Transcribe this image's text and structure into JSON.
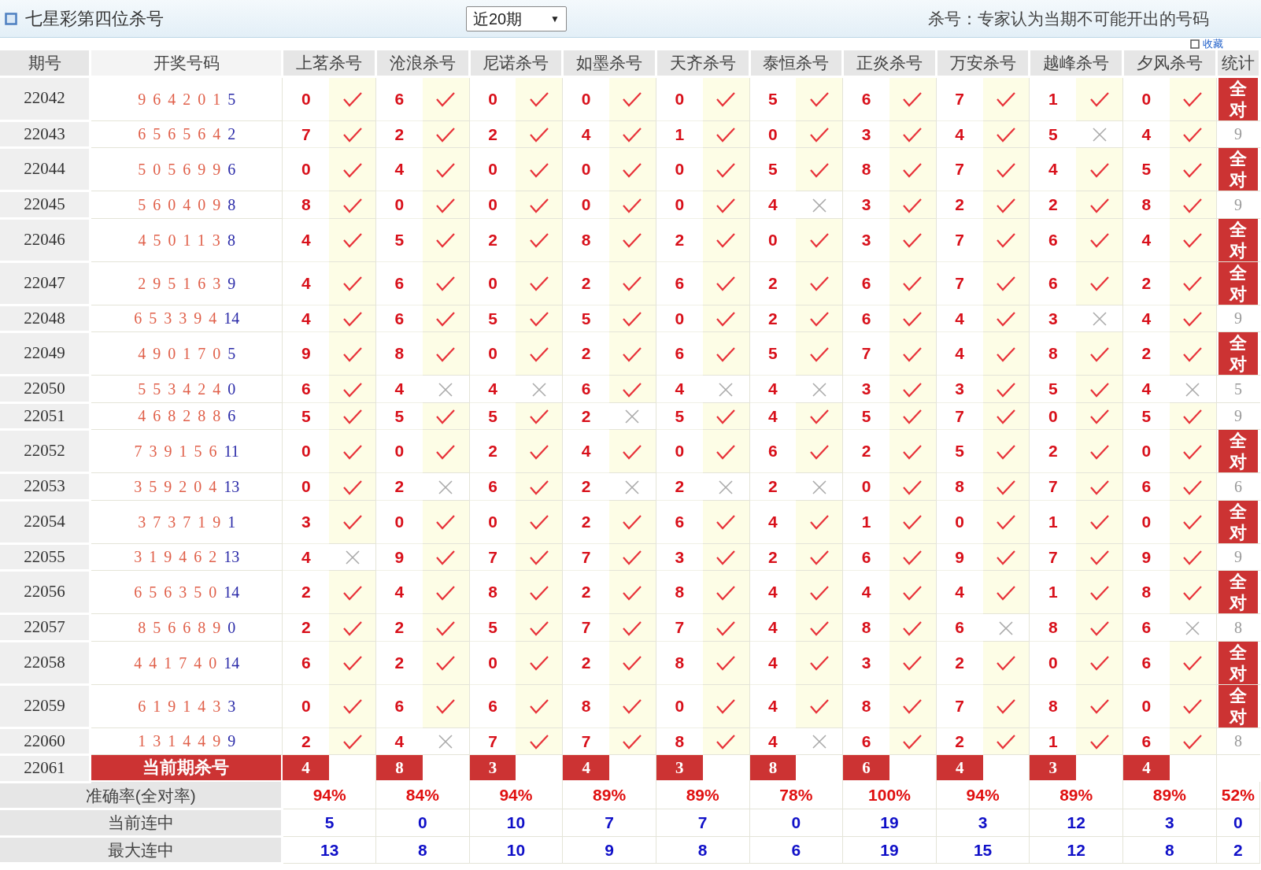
{
  "header": {
    "title": "七星彩第四位杀号",
    "period_select": {
      "value": "近20期",
      "arrow": "▼"
    },
    "note": "杀号：专家认为当期不可能开出的号码",
    "favorite": "收藏"
  },
  "table": {
    "columns": [
      "期号",
      "开奖号码",
      "上茗杀号",
      "沧浪杀号",
      "尼诺杀号",
      "如墨杀号",
      "天齐杀号",
      "泰恒杀号",
      "正炎杀号",
      "万安杀号",
      "越峰杀号",
      "夕风杀号",
      "统计"
    ],
    "rows": [
      {
        "period": "22042",
        "main": [
          "9",
          "6",
          "4",
          "2",
          "0",
          "1"
        ],
        "special": "5",
        "kills": [
          {
            "n": "0",
            "hit": true
          },
          {
            "n": "6",
            "hit": true
          },
          {
            "n": "0",
            "hit": true
          },
          {
            "n": "0",
            "hit": true
          },
          {
            "n": "0",
            "hit": true
          },
          {
            "n": "5",
            "hit": true
          },
          {
            "n": "6",
            "hit": true
          },
          {
            "n": "7",
            "hit": true
          },
          {
            "n": "1",
            "hit": true
          },
          {
            "n": "0",
            "hit": true
          }
        ],
        "stat": {
          "kind": "all_correct",
          "text": "全对"
        }
      },
      {
        "period": "22043",
        "main": [
          "6",
          "5",
          "6",
          "5",
          "6",
          "4"
        ],
        "special": "2",
        "kills": [
          {
            "n": "7",
            "hit": true
          },
          {
            "n": "2",
            "hit": true
          },
          {
            "n": "2",
            "hit": true
          },
          {
            "n": "4",
            "hit": true
          },
          {
            "n": "1",
            "hit": true
          },
          {
            "n": "0",
            "hit": true
          },
          {
            "n": "3",
            "hit": true
          },
          {
            "n": "4",
            "hit": true
          },
          {
            "n": "5",
            "hit": false
          },
          {
            "n": "4",
            "hit": true
          }
        ],
        "stat": {
          "kind": "count",
          "text": "9"
        }
      },
      {
        "period": "22044",
        "main": [
          "5",
          "0",
          "5",
          "6",
          "9",
          "9"
        ],
        "special": "6",
        "kills": [
          {
            "n": "0",
            "hit": true
          },
          {
            "n": "4",
            "hit": true
          },
          {
            "n": "0",
            "hit": true
          },
          {
            "n": "0",
            "hit": true
          },
          {
            "n": "0",
            "hit": true
          },
          {
            "n": "5",
            "hit": true
          },
          {
            "n": "8",
            "hit": true
          },
          {
            "n": "7",
            "hit": true
          },
          {
            "n": "4",
            "hit": true
          },
          {
            "n": "5",
            "hit": true
          }
        ],
        "stat": {
          "kind": "all_correct",
          "text": "全对"
        }
      },
      {
        "period": "22045",
        "main": [
          "5",
          "6",
          "0",
          "4",
          "0",
          "9"
        ],
        "special": "8",
        "kills": [
          {
            "n": "8",
            "hit": true
          },
          {
            "n": "0",
            "hit": true
          },
          {
            "n": "0",
            "hit": true
          },
          {
            "n": "0",
            "hit": true
          },
          {
            "n": "0",
            "hit": true
          },
          {
            "n": "4",
            "hit": false
          },
          {
            "n": "3",
            "hit": true
          },
          {
            "n": "2",
            "hit": true
          },
          {
            "n": "2",
            "hit": true
          },
          {
            "n": "8",
            "hit": true
          }
        ],
        "stat": {
          "kind": "count",
          "text": "9"
        }
      },
      {
        "period": "22046",
        "main": [
          "4",
          "5",
          "0",
          "1",
          "1",
          "3"
        ],
        "special": "8",
        "kills": [
          {
            "n": "4",
            "hit": true
          },
          {
            "n": "5",
            "hit": true
          },
          {
            "n": "2",
            "hit": true
          },
          {
            "n": "8",
            "hit": true
          },
          {
            "n": "2",
            "hit": true
          },
          {
            "n": "0",
            "hit": true
          },
          {
            "n": "3",
            "hit": true
          },
          {
            "n": "7",
            "hit": true
          },
          {
            "n": "6",
            "hit": true
          },
          {
            "n": "4",
            "hit": true
          }
        ],
        "stat": {
          "kind": "all_correct",
          "text": "全对"
        }
      },
      {
        "period": "22047",
        "main": [
          "2",
          "9",
          "5",
          "1",
          "6",
          "3"
        ],
        "special": "9",
        "kills": [
          {
            "n": "4",
            "hit": true
          },
          {
            "n": "6",
            "hit": true
          },
          {
            "n": "0",
            "hit": true
          },
          {
            "n": "2",
            "hit": true
          },
          {
            "n": "6",
            "hit": true
          },
          {
            "n": "2",
            "hit": true
          },
          {
            "n": "6",
            "hit": true
          },
          {
            "n": "7",
            "hit": true
          },
          {
            "n": "6",
            "hit": true
          },
          {
            "n": "2",
            "hit": true
          }
        ],
        "stat": {
          "kind": "all_correct",
          "text": "全对"
        }
      },
      {
        "period": "22048",
        "main": [
          "6",
          "5",
          "3",
          "3",
          "9",
          "4"
        ],
        "special": "14",
        "kills": [
          {
            "n": "4",
            "hit": true
          },
          {
            "n": "6",
            "hit": true
          },
          {
            "n": "5",
            "hit": true
          },
          {
            "n": "5",
            "hit": true
          },
          {
            "n": "0",
            "hit": true
          },
          {
            "n": "2",
            "hit": true
          },
          {
            "n": "6",
            "hit": true
          },
          {
            "n": "4",
            "hit": true
          },
          {
            "n": "3",
            "hit": false
          },
          {
            "n": "4",
            "hit": true
          }
        ],
        "stat": {
          "kind": "count",
          "text": "9"
        }
      },
      {
        "period": "22049",
        "main": [
          "4",
          "9",
          "0",
          "1",
          "7",
          "0"
        ],
        "special": "5",
        "kills": [
          {
            "n": "9",
            "hit": true
          },
          {
            "n": "8",
            "hit": true
          },
          {
            "n": "0",
            "hit": true
          },
          {
            "n": "2",
            "hit": true
          },
          {
            "n": "6",
            "hit": true
          },
          {
            "n": "5",
            "hit": true
          },
          {
            "n": "7",
            "hit": true
          },
          {
            "n": "4",
            "hit": true
          },
          {
            "n": "8",
            "hit": true
          },
          {
            "n": "2",
            "hit": true
          }
        ],
        "stat": {
          "kind": "all_correct",
          "text": "全对"
        }
      },
      {
        "period": "22050",
        "main": [
          "5",
          "5",
          "3",
          "4",
          "2",
          "4"
        ],
        "special": "0",
        "kills": [
          {
            "n": "6",
            "hit": true
          },
          {
            "n": "4",
            "hit": false
          },
          {
            "n": "4",
            "hit": false
          },
          {
            "n": "6",
            "hit": true
          },
          {
            "n": "4",
            "hit": false
          },
          {
            "n": "4",
            "hit": false
          },
          {
            "n": "3",
            "hit": true
          },
          {
            "n": "3",
            "hit": true
          },
          {
            "n": "5",
            "hit": true
          },
          {
            "n": "4",
            "hit": false
          }
        ],
        "stat": {
          "kind": "count",
          "text": "5"
        }
      },
      {
        "period": "22051",
        "main": [
          "4",
          "6",
          "8",
          "2",
          "8",
          "8"
        ],
        "special": "6",
        "kills": [
          {
            "n": "5",
            "hit": true
          },
          {
            "n": "5",
            "hit": true
          },
          {
            "n": "5",
            "hit": true
          },
          {
            "n": "2",
            "hit": false
          },
          {
            "n": "5",
            "hit": true
          },
          {
            "n": "4",
            "hit": true
          },
          {
            "n": "5",
            "hit": true
          },
          {
            "n": "7",
            "hit": true
          },
          {
            "n": "0",
            "hit": true
          },
          {
            "n": "5",
            "hit": true
          }
        ],
        "stat": {
          "kind": "count",
          "text": "9"
        }
      },
      {
        "period": "22052",
        "main": [
          "7",
          "3",
          "9",
          "1",
          "5",
          "6"
        ],
        "special": "11",
        "kills": [
          {
            "n": "0",
            "hit": true
          },
          {
            "n": "0",
            "hit": true
          },
          {
            "n": "2",
            "hit": true
          },
          {
            "n": "4",
            "hit": true
          },
          {
            "n": "0",
            "hit": true
          },
          {
            "n": "6",
            "hit": true
          },
          {
            "n": "2",
            "hit": true
          },
          {
            "n": "5",
            "hit": true
          },
          {
            "n": "2",
            "hit": true
          },
          {
            "n": "0",
            "hit": true
          }
        ],
        "stat": {
          "kind": "all_correct",
          "text": "全对"
        }
      },
      {
        "period": "22053",
        "main": [
          "3",
          "5",
          "9",
          "2",
          "0",
          "4"
        ],
        "special": "13",
        "kills": [
          {
            "n": "0",
            "hit": true
          },
          {
            "n": "2",
            "hit": false
          },
          {
            "n": "6",
            "hit": true
          },
          {
            "n": "2",
            "hit": false
          },
          {
            "n": "2",
            "hit": false
          },
          {
            "n": "2",
            "hit": false
          },
          {
            "n": "0",
            "hit": true
          },
          {
            "n": "8",
            "hit": true
          },
          {
            "n": "7",
            "hit": true
          },
          {
            "n": "6",
            "hit": true
          }
        ],
        "stat": {
          "kind": "count",
          "text": "6"
        }
      },
      {
        "period": "22054",
        "main": [
          "3",
          "7",
          "3",
          "7",
          "1",
          "9"
        ],
        "special": "1",
        "kills": [
          {
            "n": "3",
            "hit": true
          },
          {
            "n": "0",
            "hit": true
          },
          {
            "n": "0",
            "hit": true
          },
          {
            "n": "2",
            "hit": true
          },
          {
            "n": "6",
            "hit": true
          },
          {
            "n": "4",
            "hit": true
          },
          {
            "n": "1",
            "hit": true
          },
          {
            "n": "0",
            "hit": true
          },
          {
            "n": "1",
            "hit": true
          },
          {
            "n": "0",
            "hit": true
          }
        ],
        "stat": {
          "kind": "all_correct",
          "text": "全对"
        }
      },
      {
        "period": "22055",
        "main": [
          "3",
          "1",
          "9",
          "4",
          "6",
          "2"
        ],
        "special": "13",
        "kills": [
          {
            "n": "4",
            "hit": false
          },
          {
            "n": "9",
            "hit": true
          },
          {
            "n": "7",
            "hit": true
          },
          {
            "n": "7",
            "hit": true
          },
          {
            "n": "3",
            "hit": true
          },
          {
            "n": "2",
            "hit": true
          },
          {
            "n": "6",
            "hit": true
          },
          {
            "n": "9",
            "hit": true
          },
          {
            "n": "7",
            "hit": true
          },
          {
            "n": "9",
            "hit": true
          }
        ],
        "stat": {
          "kind": "count",
          "text": "9"
        }
      },
      {
        "period": "22056",
        "main": [
          "6",
          "5",
          "6",
          "3",
          "5",
          "0"
        ],
        "special": "14",
        "kills": [
          {
            "n": "2",
            "hit": true
          },
          {
            "n": "4",
            "hit": true
          },
          {
            "n": "8",
            "hit": true
          },
          {
            "n": "2",
            "hit": true
          },
          {
            "n": "8",
            "hit": true
          },
          {
            "n": "4",
            "hit": true
          },
          {
            "n": "4",
            "hit": true
          },
          {
            "n": "4",
            "hit": true
          },
          {
            "n": "1",
            "hit": true
          },
          {
            "n": "8",
            "hit": true
          }
        ],
        "stat": {
          "kind": "all_correct",
          "text": "全对"
        }
      },
      {
        "period": "22057",
        "main": [
          "8",
          "5",
          "6",
          "6",
          "8",
          "9"
        ],
        "special": "0",
        "kills": [
          {
            "n": "2",
            "hit": true
          },
          {
            "n": "2",
            "hit": true
          },
          {
            "n": "5",
            "hit": true
          },
          {
            "n": "7",
            "hit": true
          },
          {
            "n": "7",
            "hit": true
          },
          {
            "n": "4",
            "hit": true
          },
          {
            "n": "8",
            "hit": true
          },
          {
            "n": "6",
            "hit": false
          },
          {
            "n": "8",
            "hit": true
          },
          {
            "n": "6",
            "hit": false
          }
        ],
        "stat": {
          "kind": "count",
          "text": "8"
        }
      },
      {
        "period": "22058",
        "main": [
          "4",
          "4",
          "1",
          "7",
          "4",
          "0"
        ],
        "special": "14",
        "kills": [
          {
            "n": "6",
            "hit": true
          },
          {
            "n": "2",
            "hit": true
          },
          {
            "n": "0",
            "hit": true
          },
          {
            "n": "2",
            "hit": true
          },
          {
            "n": "8",
            "hit": true
          },
          {
            "n": "4",
            "hit": true
          },
          {
            "n": "3",
            "hit": true
          },
          {
            "n": "2",
            "hit": true
          },
          {
            "n": "0",
            "hit": true
          },
          {
            "n": "6",
            "hit": true
          }
        ],
        "stat": {
          "kind": "all_correct",
          "text": "全对"
        }
      },
      {
        "period": "22059",
        "main": [
          "6",
          "1",
          "9",
          "1",
          "4",
          "3"
        ],
        "special": "3",
        "kills": [
          {
            "n": "0",
            "hit": true
          },
          {
            "n": "6",
            "hit": true
          },
          {
            "n": "6",
            "hit": true
          },
          {
            "n": "8",
            "hit": true
          },
          {
            "n": "0",
            "hit": true
          },
          {
            "n": "4",
            "hit": true
          },
          {
            "n": "8",
            "hit": true
          },
          {
            "n": "7",
            "hit": true
          },
          {
            "n": "8",
            "hit": true
          },
          {
            "n": "0",
            "hit": true
          }
        ],
        "stat": {
          "kind": "all_correct",
          "text": "全对"
        }
      },
      {
        "period": "22060",
        "main": [
          "1",
          "3",
          "1",
          "4",
          "4",
          "9"
        ],
        "special": "9",
        "kills": [
          {
            "n": "2",
            "hit": true
          },
          {
            "n": "4",
            "hit": false
          },
          {
            "n": "7",
            "hit": true
          },
          {
            "n": "7",
            "hit": true
          },
          {
            "n": "8",
            "hit": true
          },
          {
            "n": "4",
            "hit": false
          },
          {
            "n": "6",
            "hit": true
          },
          {
            "n": "2",
            "hit": true
          },
          {
            "n": "1",
            "hit": true
          },
          {
            "n": "6",
            "hit": true
          }
        ],
        "stat": {
          "kind": "count",
          "text": "8"
        }
      }
    ],
    "current": {
      "period": "22061",
      "label": "当前期杀号",
      "kills": [
        "4",
        "8",
        "3",
        "4",
        "3",
        "8",
        "6",
        "4",
        "3",
        "4"
      ]
    },
    "summary": [
      {
        "kind": "rate",
        "label": "准确率(全对率)",
        "values": [
          "94%",
          "84%",
          "94%",
          "89%",
          "89%",
          "78%",
          "100%",
          "94%",
          "89%",
          "89%",
          "52%"
        ]
      },
      {
        "kind": "streak",
        "label": "当前连中",
        "values": [
          "5",
          "0",
          "10",
          "7",
          "7",
          "0",
          "19",
          "3",
          "12",
          "3",
          "0"
        ]
      },
      {
        "kind": "streak",
        "label": "最大连中",
        "values": [
          "13",
          "8",
          "10",
          "9",
          "8",
          "6",
          "19",
          "15",
          "12",
          "8",
          "2"
        ]
      }
    ]
  }
}
